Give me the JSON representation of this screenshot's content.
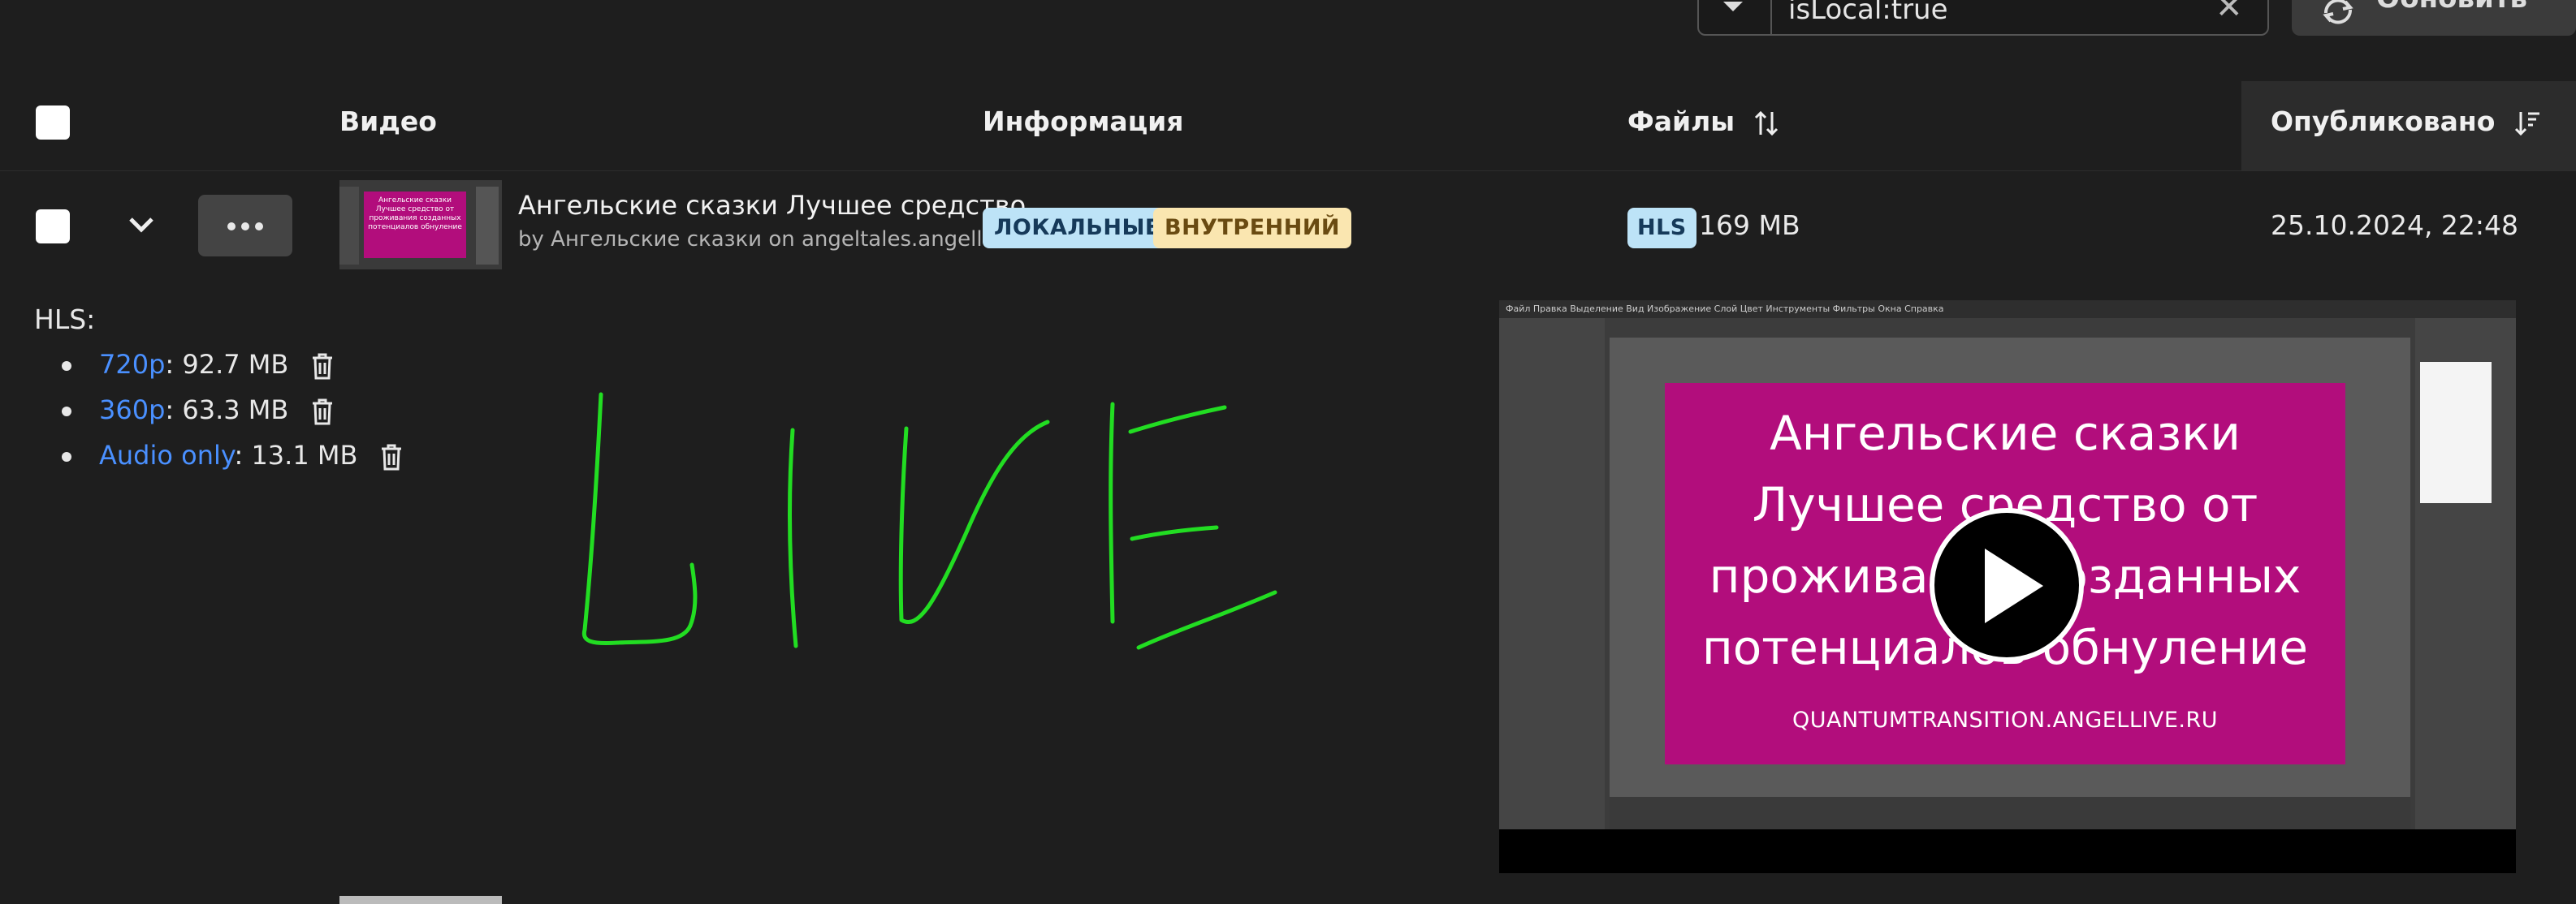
{
  "filter": {
    "query": "isLocal:true",
    "clear_glyph": "✕",
    "refresh_label": "Обновить"
  },
  "table": {
    "columns": {
      "video": "Видео",
      "info": "Информация",
      "files": "Файлы",
      "published": "Опубликовано"
    }
  },
  "row": {
    "title": "Ангельские сказки Лучшее средство",
    "subtitle": "by Ангельские сказки on angeltales.angellive.",
    "badges": {
      "local": "ЛОКАЛЬНЫЕ",
      "internal": "ВНУТРЕННИЙ"
    },
    "files_badge": "HLS",
    "files_size": "169 MB",
    "published": "25.10.2024, 22:48",
    "thumb_text": "Ангельские сказки Лучшее средство от проживания созданных потенциалов обнуление"
  },
  "details": {
    "label": "HLS:",
    "resolutions": [
      {
        "name": "720p",
        "size": ": 92.7 MB"
      },
      {
        "name": "360p",
        "size": ": 63.3 MB"
      },
      {
        "name": "Audio only",
        "size": ": 13.1 MB"
      }
    ]
  },
  "preview": {
    "gimp_menu": "Файл  Правка  Выделение  Вид  Изображение  Слой  Цвет  Инструменты  Фильтры  Окна  Справка",
    "lines": [
      "Ангельские сказки",
      "Лучшее средство от",
      "проживания созданных",
      "потенциалов обнуление"
    ],
    "url": "QUANTUMTRANSITION.ANGELLIVE.RU"
  },
  "annotation": {
    "live_text": "LIVE",
    "color": "#22dd22"
  },
  "colors": {
    "link": "#4a90ff",
    "badge_blue": "#bde3f7",
    "badge_yellow": "#fae6b0",
    "magenta": "#b20d7c"
  }
}
